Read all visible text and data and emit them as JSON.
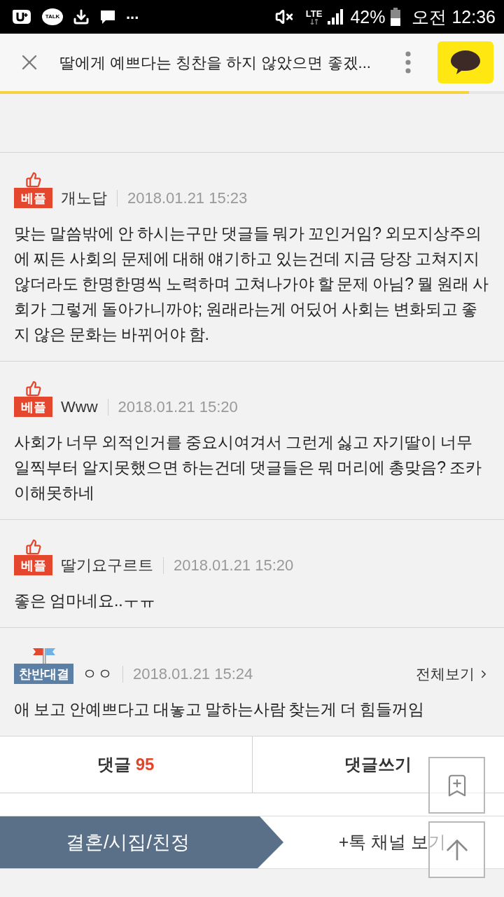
{
  "status_bar": {
    "talk_label": "TALK",
    "more_notifications": "...",
    "network": "LTE",
    "battery": "42%",
    "time": "오전 12:36"
  },
  "header": {
    "title": "딸에게 예쁘다는 칭찬을 하지 않았으면 좋겠...",
    "progress": {
      "level": 0.93
    }
  },
  "comments": [
    {
      "badge": {
        "kind": "best",
        "label": "베플"
      },
      "author": "개노답",
      "date": "2018.01.21 15:23",
      "text": "맞는 말씀밖에 안 하시는구만 댓글들 뭐가 꼬인거임? 외모지상주의에 찌든 사회의 문제에 대해 얘기하고 있는건데 지금 당장 고쳐지지 않더라도 한명한명씩 노력하며 고쳐나가야 할 문제 아님? 뭘 원래 사회가 그렇게 돌아가니까야; 원래라는게 어딨어 사회는 변화되고 좋지 않은 문화는 바뀌어야 함."
    },
    {
      "badge": {
        "kind": "best",
        "label": "베플"
      },
      "author": "Www",
      "date": "2018.01.21 15:20",
      "text": "사회가 너무 외적인거를 중요시여겨서 그런게 싫고 자기딸이 너무 일찍부터 알지못했으면 하는건데 댓글들은 뭐 머리에 총맞음? 조카 이해못하네"
    },
    {
      "badge": {
        "kind": "best",
        "label": "베플"
      },
      "author": "딸기요구르트",
      "date": "2018.01.21 15:20",
      "text": "좋은 엄마네요..ㅜㅠ"
    },
    {
      "badge": {
        "kind": "debate",
        "label": "찬반대결"
      },
      "author": "ㅇㅇ",
      "date": "2018.01.21 15:24",
      "link": "전체보기",
      "text": "애 보고 안예쁘다고 대놓고 말하는사람 찾는게 더 힘들꺼임"
    }
  ],
  "comment_bar": {
    "comments_label": "댓글",
    "comments_count": "95",
    "write_label": "댓글쓰기"
  },
  "channel_bar": {
    "channel": "결혼/시집/친정",
    "more": "+톡 채널 보기"
  }
}
